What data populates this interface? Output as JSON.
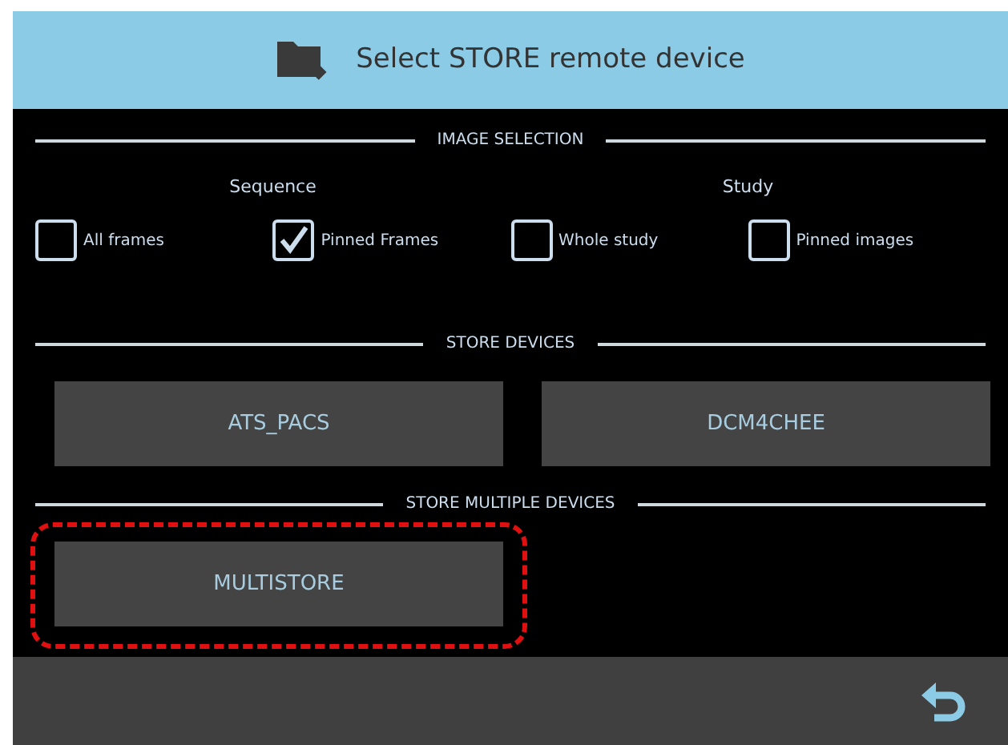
{
  "header": {
    "title": "Select STORE remote device"
  },
  "sections": [
    {
      "heading": "IMAGE SELECTION",
      "kind": "options",
      "groups": [
        {
          "label": "Sequence",
          "options": [
            {
              "label": "All frames",
              "checked": false
            },
            {
              "label": "Pinned Frames",
              "checked": true
            }
          ]
        },
        {
          "label": "Study",
          "options": [
            {
              "label": "Whole study",
              "checked": false
            },
            {
              "label": "Pinned images",
              "checked": false
            }
          ]
        }
      ]
    },
    {
      "heading": "STORE DEVICES",
      "kind": "buttons",
      "buttons": [
        {
          "label": "ATS_PACS",
          "highlighted": false
        },
        {
          "label": "DCM4CHEE",
          "highlighted": false
        }
      ]
    },
    {
      "heading": "STORE MULTIPLE DEVICES",
      "kind": "buttons",
      "buttons": [
        {
          "label": "MULTISTORE",
          "highlighted": true
        }
      ]
    }
  ]
}
